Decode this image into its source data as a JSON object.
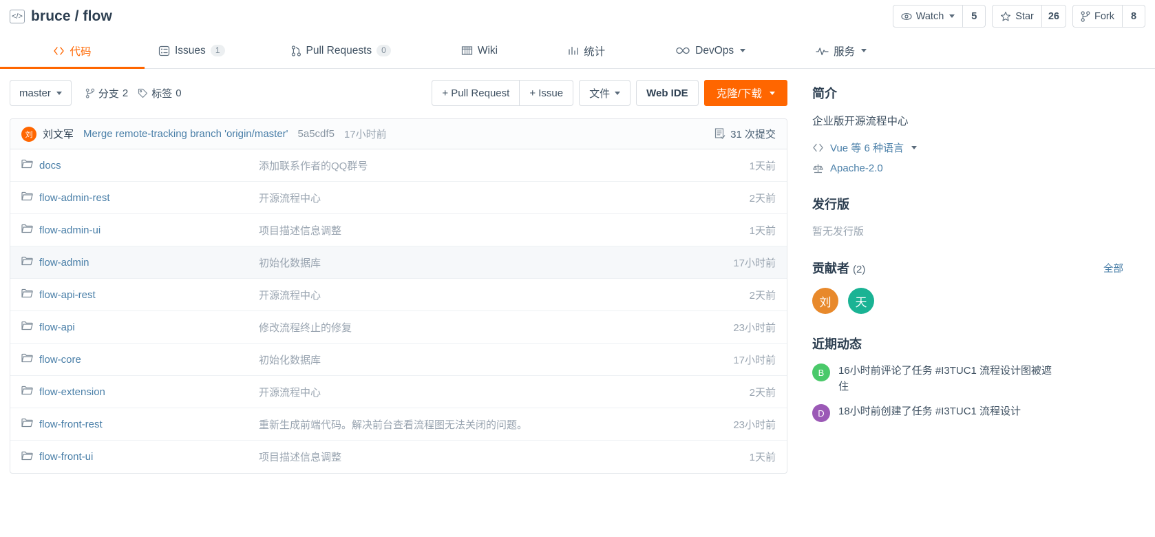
{
  "header": {
    "repo_icon": "code-brackets-icon",
    "owner": "bruce",
    "separator": "/",
    "repo": "flow",
    "title": "bruce / flow",
    "actions": [
      {
        "icon": "eye-icon",
        "label": "Watch",
        "count": "5",
        "has_caret": true
      },
      {
        "icon": "star-icon",
        "label": "Star",
        "count": "26",
        "has_caret": false
      },
      {
        "icon": "fork-icon",
        "label": "Fork",
        "count": "8",
        "has_caret": false
      }
    ]
  },
  "nav": {
    "tabs": [
      {
        "icon": "code-icon",
        "label": "代码",
        "badge": null,
        "active": true,
        "caret": false
      },
      {
        "icon": "issues-icon",
        "label": "Issues",
        "badge": "1",
        "active": false,
        "caret": false
      },
      {
        "icon": "pull-request-icon",
        "label": "Pull Requests",
        "badge": "0",
        "active": false,
        "caret": false
      },
      {
        "icon": "wiki-icon",
        "label": "Wiki",
        "badge": null,
        "active": false,
        "caret": false
      },
      {
        "icon": "chart-icon",
        "label": "统计",
        "badge": null,
        "active": false,
        "caret": false
      },
      {
        "icon": "infinity-icon",
        "label": "DevOps",
        "badge": null,
        "active": false,
        "caret": true
      },
      {
        "icon": "pulse-icon",
        "label": "服务",
        "badge": null,
        "active": false,
        "caret": true
      }
    ]
  },
  "toolbar": {
    "branch": "master",
    "branches_icon": "branch-icon",
    "branches_label": "分支",
    "branches_count": "2",
    "tags_icon": "tag-icon",
    "tags_label": "标签",
    "tags_count": "0",
    "pull_request_btn": "+ Pull Request",
    "issue_btn": "+ Issue",
    "files_btn": "文件",
    "web_ide_btn": "Web IDE",
    "clone_btn": "克隆/下载"
  },
  "commit_bar": {
    "avatar_initial": "刘",
    "avatar_color": "#f60",
    "author": "刘文军",
    "message": "Merge remote-tracking branch 'origin/master'",
    "sha": "5a5cdf5",
    "time": "17小时前",
    "count_icon": "commits-icon",
    "count_label": "31 次提交"
  },
  "files": [
    {
      "icon": "folder-icon",
      "name": "docs",
      "message": "添加联系作者的QQ群号",
      "time": "1天前",
      "hover": false
    },
    {
      "icon": "folder-icon",
      "name": "flow-admin-rest",
      "message": "开源流程中心",
      "time": "2天前",
      "hover": false
    },
    {
      "icon": "folder-icon",
      "name": "flow-admin-ui",
      "message": "项目描述信息调整",
      "time": "1天前",
      "hover": false
    },
    {
      "icon": "folder-icon",
      "name": "flow-admin",
      "message": "初始化数据库",
      "time": "17小时前",
      "hover": true
    },
    {
      "icon": "folder-icon",
      "name": "flow-api-rest",
      "message": "开源流程中心",
      "time": "2天前",
      "hover": false
    },
    {
      "icon": "folder-icon",
      "name": "flow-api",
      "message": "修改流程终止的修复",
      "time": "23小时前",
      "hover": false
    },
    {
      "icon": "folder-icon",
      "name": "flow-core",
      "message": "初始化数据库",
      "time": "17小时前",
      "hover": false
    },
    {
      "icon": "folder-icon",
      "name": "flow-extension",
      "message": "开源流程中心",
      "time": "2天前",
      "hover": false
    },
    {
      "icon": "folder-icon",
      "name": "flow-front-rest",
      "message": "重新生成前端代码。解决前台查看流程图无法关闭的问题。",
      "time": "23小时前",
      "hover": false
    },
    {
      "icon": "folder-icon",
      "name": "flow-front-ui",
      "message": "项目描述信息调整",
      "time": "1天前",
      "hover": false
    }
  ],
  "sidebar": {
    "about_title": "简介",
    "about_desc": "企业版开源流程中心",
    "language_icon": "code-icon",
    "language": "Vue 等 6 种语言",
    "license_icon": "balance-scale-icon",
    "license": "Apache-2.0",
    "releases_title": "发行版",
    "releases_empty": "暂无发行版",
    "contributors_title": "贡献者",
    "contributors_count": "(2)",
    "contributors_all": "全部",
    "contributors": [
      {
        "initial": "刘",
        "color": "#e8892b"
      },
      {
        "initial": "天",
        "color": "#1ab394"
      }
    ],
    "activity_title": "近期动态",
    "activity": [
      {
        "initial": "B",
        "color": "#4ac96a",
        "text": "16小时前评论了任务 #I3TUC1 流程设计图被遮住"
      },
      {
        "initial": "D",
        "color": "#9b59b6",
        "text": "18小时前创建了任务 #I3TUC1 流程设计"
      }
    ]
  },
  "colors": {
    "accent": "#f60",
    "link": "#4a7fa8",
    "text": "#2c3e50",
    "muted": "#9aa5b1"
  }
}
